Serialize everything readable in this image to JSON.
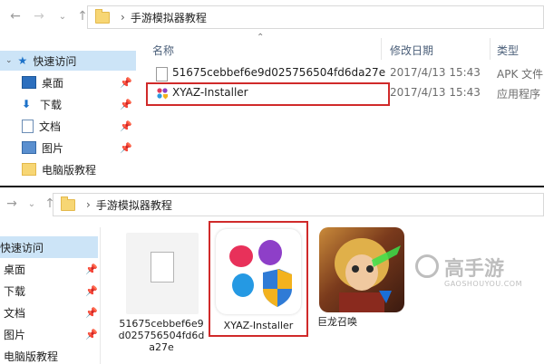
{
  "top": {
    "breadcrumb": "手游模拟器教程",
    "columns": {
      "name": "名称",
      "modified": "修改日期",
      "type": "类型"
    },
    "sidebar": [
      {
        "label": "快速访问",
        "icon": "star-icon",
        "pinned": false
      },
      {
        "label": "桌面",
        "icon": "desktop-icon",
        "pinned": true
      },
      {
        "label": "下载",
        "icon": "download-icon",
        "pinned": true
      },
      {
        "label": "文档",
        "icon": "document-icon",
        "pinned": true
      },
      {
        "label": "图片",
        "icon": "picture-icon",
        "pinned": true
      },
      {
        "label": "电脑版教程",
        "icon": "folder-icon",
        "pinned": false
      }
    ],
    "files": [
      {
        "name": "51675cebbef6e9d025756504fd6da27e",
        "modified": "2017/4/13 15:43",
        "type": "APK 文件"
      },
      {
        "name": "XYAZ-Installer",
        "modified": "2017/4/13 15:43",
        "type": "应用程序"
      }
    ]
  },
  "bottom": {
    "breadcrumb": "手游模拟器教程",
    "sidebar": [
      {
        "label": "快速访问",
        "pinned": false
      },
      {
        "label": "桌面",
        "pinned": true
      },
      {
        "label": "下载",
        "pinned": true
      },
      {
        "label": "文档",
        "pinned": true
      },
      {
        "label": "图片",
        "pinned": true
      },
      {
        "label": "电脑版教程",
        "pinned": false
      }
    ],
    "tiles": [
      {
        "label": "51675cebbef6e9d025756504fd6da27e",
        "icon": "blank-file-icon"
      },
      {
        "label": "XYAZ-Installer",
        "icon": "xyaz-installer-icon"
      },
      {
        "label": "巨龙召唤",
        "icon": "game-app-icon"
      }
    ],
    "watermark": {
      "text": "高手游",
      "subtext": "GAOSHOUYOU.COM"
    }
  },
  "colors": {
    "highlight_box": "#d02a2a",
    "sidebar_selected": "#cce4f7",
    "folder": "#f7d674"
  }
}
